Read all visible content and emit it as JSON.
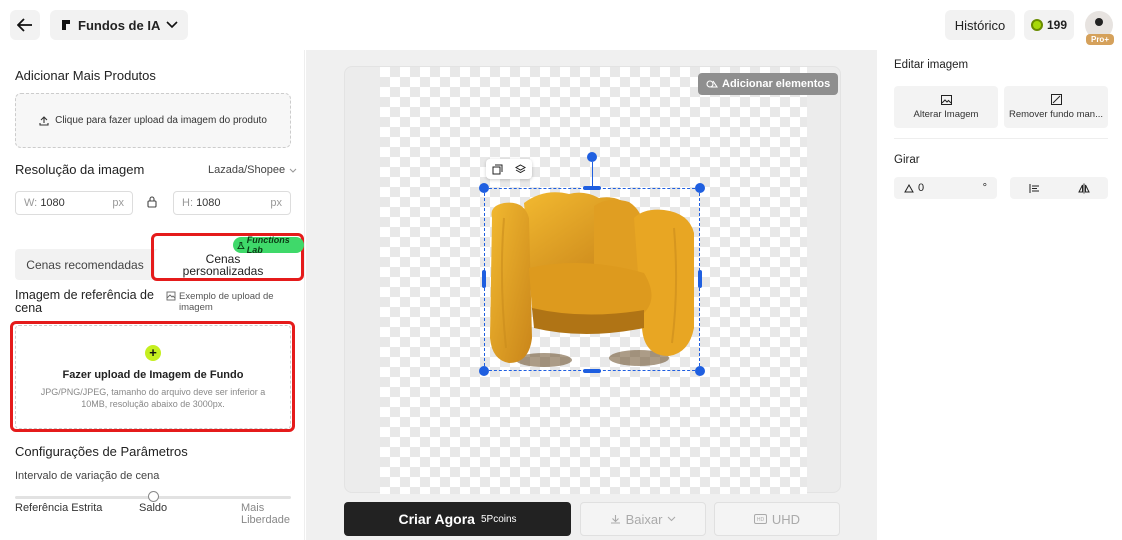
{
  "header": {
    "app_name": "Fundos de IA",
    "history_label": "Histórico",
    "coin_count": "199",
    "pro_label": "Pro+"
  },
  "left_panel": {
    "add_products_title": "Adicionar Mais Produtos",
    "upload_product_label": "Clique para fazer upload da imagem do produto",
    "resolution_title": "Resolução da imagem",
    "platform_preset": "Lazada/Shopee",
    "width_label": "W:",
    "width_value": "1080",
    "height_label": "H:",
    "height_value": "1080",
    "unit": "px",
    "tab_recommended": "Cenas recomendadas",
    "tab_custom": "Cenas personalizadas",
    "lab_badge": "Functions Lab",
    "reference_title": "Imagem de referência de cena",
    "example_link": "Exemplo de upload de imagem",
    "upload_bg_title": "Fazer upload de Imagem de Fundo",
    "upload_bg_desc": "JPG/PNG/JPEG, tamanho do arquivo deve ser inferior a 10MB, resolução abaixo de 3000px.",
    "params_title": "Configurações de Parâmetros",
    "range_label": "Intervalo de variação de cena",
    "slider_value": 0.5,
    "slider_left": "Referência Estrita",
    "slider_mid": "Saldo",
    "slider_right": "Mais Liberdade"
  },
  "canvas": {
    "add_elements_label": "Adicionar elementos",
    "create_label": "Criar Agora",
    "create_cost": "5Pcoins",
    "download_label": "Baixar",
    "uhd_label": "UHD"
  },
  "right_panel": {
    "edit_title": "Editar imagem",
    "change_image": "Alterar Imagem",
    "remove_bg": "Remover fundo man...",
    "rotate_title": "Girar",
    "rotation_value": "0",
    "degree_symbol": "°"
  },
  "colors": {
    "accent": "#1f5fe0",
    "highlight_red": "#e51b1b",
    "lime": "#c5ef20",
    "lab_green": "#3fd96a",
    "chair": "#e8a623"
  },
  "icons": [
    "arrow-left-icon",
    "app-logo-icon",
    "chevron-down-icon",
    "coin-icon",
    "upload-icon",
    "lock-icon",
    "flask-icon",
    "image-icon",
    "plus-icon",
    "shapes-icon",
    "copy-icon",
    "layers-icon",
    "download-icon",
    "hd-icon",
    "angle-icon",
    "align-icon",
    "flip-icon"
  ]
}
